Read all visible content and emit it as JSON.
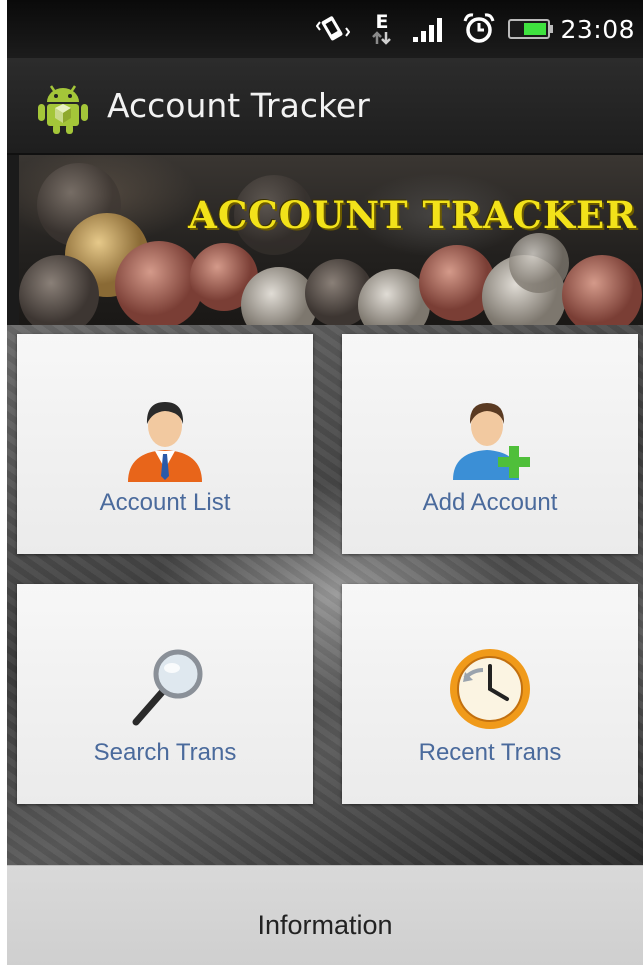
{
  "status_bar": {
    "time": "23:08",
    "icons": [
      "vibrate-icon",
      "edge-data-icon",
      "signal-icon",
      "alarm-icon",
      "battery-icon"
    ],
    "data_type_letter": "E"
  },
  "action_bar": {
    "title": "Account Tracker",
    "icon": "android-icon"
  },
  "banner": {
    "text": "ACCOUNT TRACKER"
  },
  "tiles": [
    {
      "label": "Account List",
      "icon": "user-icon"
    },
    {
      "label": "Add Account",
      "icon": "add-user-icon"
    },
    {
      "label": "Search Trans",
      "icon": "magnifier-icon"
    },
    {
      "label": "Recent Trans",
      "icon": "clock-icon"
    }
  ],
  "footer": {
    "label": "Information"
  },
  "colors": {
    "tile_label": "#4a6a9c",
    "banner_text": "#f2e21a",
    "android_green": "#a4c639",
    "battery_green": "#3fe23f"
  }
}
